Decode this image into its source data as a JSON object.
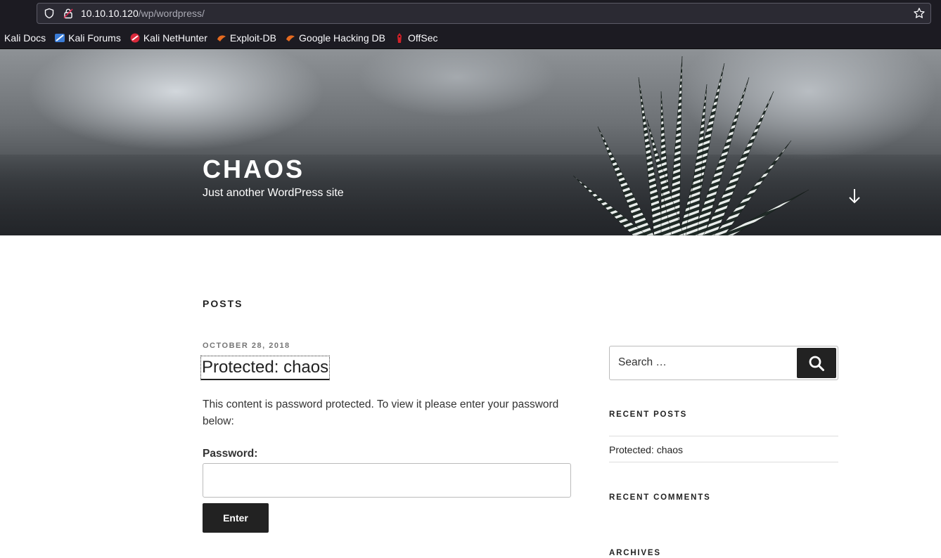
{
  "browser": {
    "url_host": "10.10.10.120",
    "url_path": "/wp/wordpress/",
    "bookmarks": [
      {
        "label": "Kali Docs",
        "icon": "none"
      },
      {
        "label": "Kali Forums",
        "icon": "kali-forums-icon"
      },
      {
        "label": "Kali NetHunter",
        "icon": "nethunter-icon"
      },
      {
        "label": "Exploit-DB",
        "icon": "exploitdb-icon"
      },
      {
        "label": "Google Hacking DB",
        "icon": "ghdb-icon"
      },
      {
        "label": "OffSec",
        "icon": "offsec-icon"
      }
    ]
  },
  "header": {
    "site_title": "CHAOS",
    "site_description": "Just another WordPress site"
  },
  "main": {
    "section_heading": "POSTS",
    "post": {
      "date": "OCTOBER 28, 2018",
      "title": "Protected: chaos",
      "body": "This content is password protected. To view it please enter your password below:",
      "password_label": "Password:",
      "password_value": "",
      "submit_label": "Enter"
    }
  },
  "sidebar": {
    "search_placeholder": "Search …",
    "recent_posts_title": "RECENT POSTS",
    "recent_posts": [
      "Protected: chaos"
    ],
    "recent_comments_title": "RECENT COMMENTS",
    "archives_title": "ARCHIVES"
  },
  "colors": {
    "browser_bg": "#1c1b22",
    "urlbar_bg": "#2b2a33",
    "button_dark": "#222222",
    "date_gray": "#767676"
  }
}
